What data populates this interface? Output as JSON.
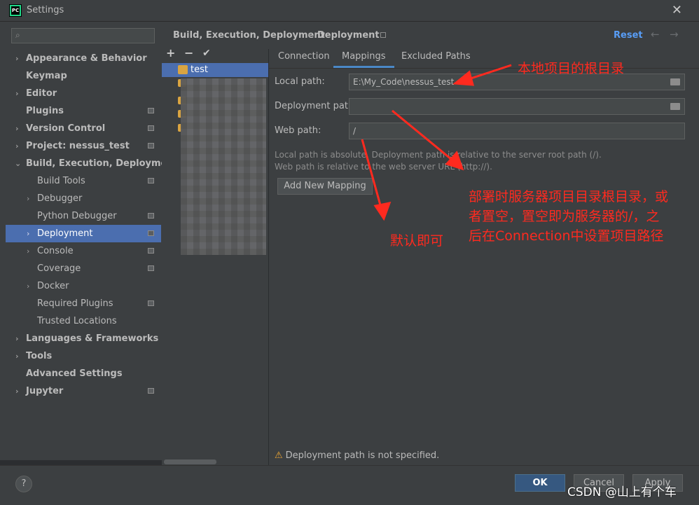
{
  "window": {
    "title": "Settings",
    "app_logo": "PC"
  },
  "search": {
    "placeholder": ""
  },
  "sidebar": {
    "items": [
      {
        "label": "Appearance & Behavior",
        "chevron": "›"
      },
      {
        "label": "Keymap"
      },
      {
        "label": "Editor",
        "chevron": "›"
      },
      {
        "label": "Plugins"
      },
      {
        "label": "Version Control",
        "chevron": "›"
      },
      {
        "label": "Project: nessus_test",
        "chevron": "›"
      },
      {
        "label": "Build, Execution, Deployment",
        "chevron": "⌄"
      },
      {
        "label": "Build Tools"
      },
      {
        "label": "Debugger",
        "chevron": "›"
      },
      {
        "label": "Python Debugger"
      },
      {
        "label": "Deployment",
        "chevron": "›"
      },
      {
        "label": "Console",
        "chevron": "›"
      },
      {
        "label": "Coverage"
      },
      {
        "label": "Docker",
        "chevron": "›"
      },
      {
        "label": "Required Plugins"
      },
      {
        "label": "Trusted Locations"
      },
      {
        "label": "Languages & Frameworks",
        "chevron": "›"
      },
      {
        "label": "Tools",
        "chevron": "›"
      },
      {
        "label": "Advanced Settings"
      },
      {
        "label": "Jupyter",
        "chevron": "›"
      }
    ]
  },
  "header": {
    "breadcrumb_parent": "Build, Execution, Deployment",
    "separator": "›",
    "breadcrumb_current": "Deployment",
    "reset": "Reset"
  },
  "servers": {
    "toolbar": {
      "add": "+",
      "remove": "−",
      "apply": "✔"
    },
    "items": [
      {
        "name": "test"
      }
    ]
  },
  "tabs": [
    "Connection",
    "Mappings",
    "Excluded Paths"
  ],
  "mappings": {
    "local_path_label": "Local path:",
    "local_path_value": "E:\\My_Code\\nessus_test",
    "deployment_path_label": "Deployment path:",
    "deployment_path_value": "",
    "web_path_label": "Web path:",
    "web_path_value": "/",
    "hint_line1": "Local path is absolute. Deployment path is relative to the server root path (/).",
    "hint_line2": "Web path is relative to the web server URL (http://).",
    "add_mapping": "Add New Mapping",
    "warning": "Deployment path is not specified."
  },
  "footer": {
    "help": "?",
    "ok": "OK",
    "cancel": "Cancel",
    "apply": "Apply"
  },
  "annotations": {
    "local_root": "本地项目的根目录",
    "deploy_line1": "部署时服务器项目目录根目录，或",
    "deploy_line2": "者置空，置空即为服务器的/，之",
    "deploy_line3": "后在Connection中设置项目路径",
    "default_ok": "默认即可",
    "color": "#ff2a1f"
  },
  "watermark": "CSDN @山上有个车"
}
